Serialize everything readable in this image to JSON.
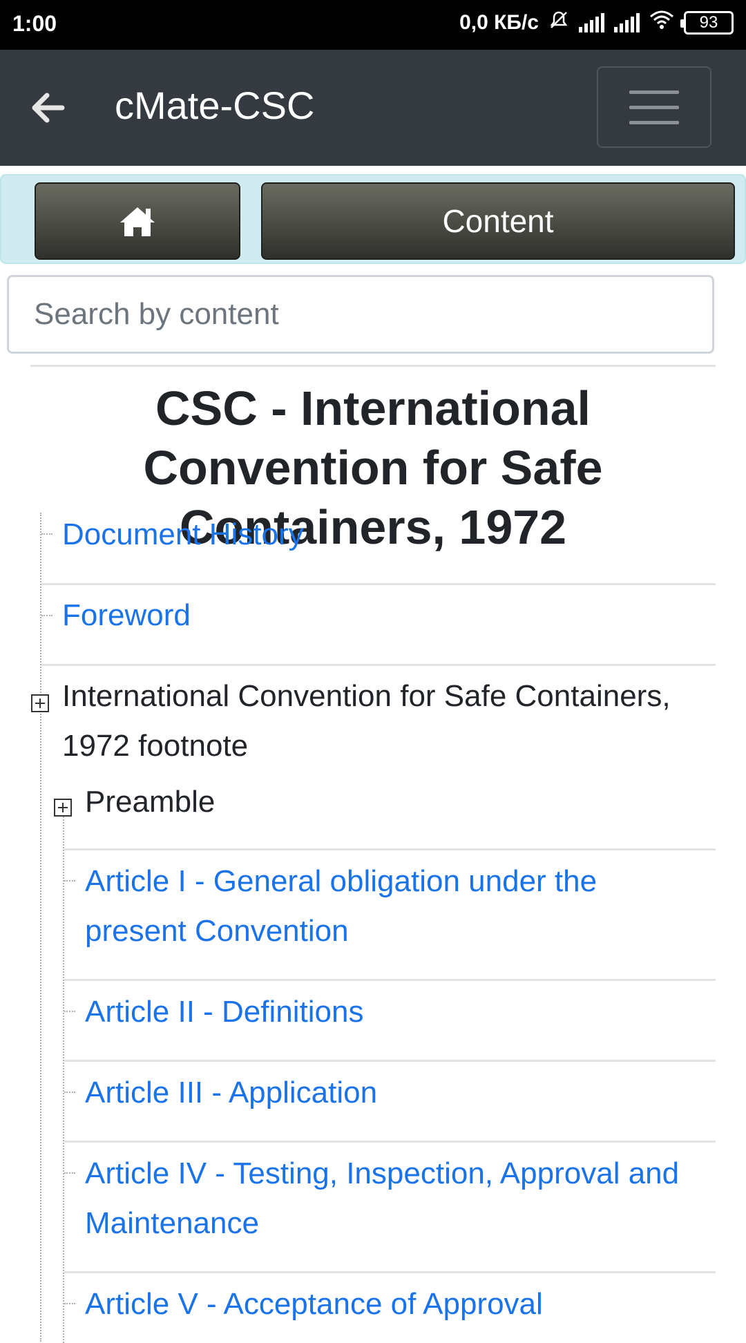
{
  "status_bar": {
    "time": "1:00",
    "network_speed": "0,0 КБ/с",
    "battery": "93",
    "icons": [
      "mute-bell-icon",
      "signal-icon",
      "signal-icon",
      "wifi-icon",
      "battery-icon"
    ]
  },
  "app_bar": {
    "title": "cMate-CSC",
    "back_icon": "arrow-left-icon",
    "menu_icon": "hamburger-menu-icon"
  },
  "nav": {
    "home_icon": "home-icon",
    "content_label": "Content"
  },
  "search": {
    "placeholder": "Search by content",
    "value": ""
  },
  "page_title": "CSC - International Convention for Safe Containers, 1972",
  "tree": {
    "items": [
      {
        "label": "Document History",
        "link": true
      },
      {
        "label": "Foreword",
        "link": true
      },
      {
        "label": "International Convention for Safe Containers, 1972 footnote",
        "link": false,
        "expandable": true
      },
      {
        "label": "Preamble",
        "link": false,
        "expandable": true
      },
      {
        "label": "Article I - General obligation under the present Convention",
        "link": true
      },
      {
        "label": "Article II - Definitions",
        "link": true
      },
      {
        "label": "Article III - Application",
        "link": true
      },
      {
        "label": "Article IV - Testing, Inspection, Approval and Maintenance",
        "link": true
      },
      {
        "label": "Article V - Acceptance of Approval",
        "link": true
      }
    ]
  },
  "colors": {
    "app_bar": "#343a40",
    "link": "#1a73e8",
    "nav_strip": "#d1ecf1"
  }
}
